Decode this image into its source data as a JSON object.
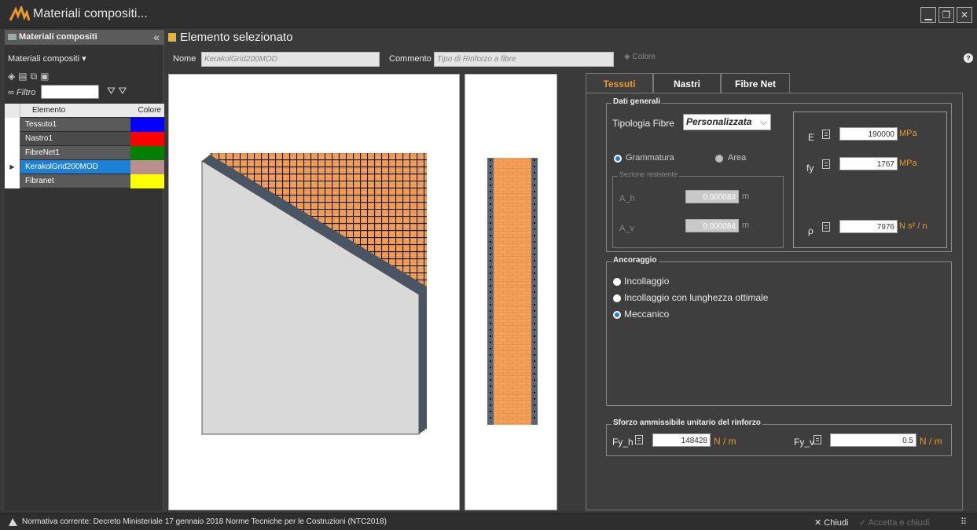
{
  "window": {
    "title": "Materiali compositi...",
    "controls": [
      "minimize",
      "restore",
      "close"
    ]
  },
  "left_panel": {
    "header_title": "Materiali compositi",
    "subtitle": "Materiali compositi",
    "filter_label": "Filtro",
    "filter_value": "",
    "columns": [
      "Elemento",
      "Colore"
    ],
    "rows": [
      {
        "name": "Tessuto1",
        "color": "#0000ff",
        "selected": false
      },
      {
        "name": "Nastro1",
        "color": "#ff0000",
        "selected": false
      },
      {
        "name": "FibreNet1",
        "color": "#008000",
        "selected": false
      },
      {
        "name": "KerakolGrid200MOD",
        "color": "#bc8f8f",
        "selected": true
      },
      {
        "name": "Fibranet",
        "color": "#ffff00",
        "selected": false
      }
    ]
  },
  "header": {
    "title": "Elemento selezionato",
    "name_label": "Nome",
    "name_value": "KerakolGrid200MOD",
    "comment_label": "Commento",
    "comment_placeholder": "Tipo di Rinforzo a fibre",
    "color_button": "Colore"
  },
  "tabs": [
    "Tessuti",
    "Nastri",
    "Fibre Net"
  ],
  "active_tab": "Tessuti",
  "dati_generali": {
    "title": "Dati generali",
    "tipologia_label": "Tipologia Fibre",
    "tipologia_value": "Personalizzata",
    "option_grammatura": "Grammatura",
    "option_area": "Area",
    "sezione_title": "Sezione resistente",
    "a_h_label": "A_h",
    "a_h_value": "0.000084",
    "a_h_unit": "m",
    "a_v_label": "A_v",
    "a_v_value": "0.000084",
    "a_v_unit": "m",
    "E_label": "E",
    "E_value": "190000",
    "E_unit": "MPa",
    "fy_label": "fy",
    "fy_value": "1767",
    "fy_unit": "MPa",
    "rho_label": "ρ",
    "rho_value": "7976",
    "rho_unit": "N s² / n"
  },
  "ancoraggio": {
    "title": "Ancoraggio",
    "options": [
      "Incollaggio",
      "Incollaggio con lunghezza ottimale",
      "Meccanico"
    ],
    "selected": "Meccanico"
  },
  "sforzo": {
    "title": "Sforzo ammissibile unitario del rinforzo",
    "fy_h_label": "Fy_h",
    "fy_h_value": "148428",
    "fy_h_unit": "N / m",
    "fy_v_label": "Fy_v",
    "fy_v_value": "0.5",
    "fy_v_unit": "N / m"
  },
  "status": {
    "text": "Normativa corrente:  Decreto Ministeriale 17 gennaio 2018 Norme Tecniche per le Costruzioni (NTC2018)",
    "close_label": "Chiudi",
    "accept_label": "Accetta e chiudi"
  },
  "colors": {
    "accent": "#e89a2c",
    "selection": "#1e7fd6",
    "brick": "#f2a35c",
    "mesh": "#1a1a1a",
    "wall": "#d9d9d9"
  }
}
